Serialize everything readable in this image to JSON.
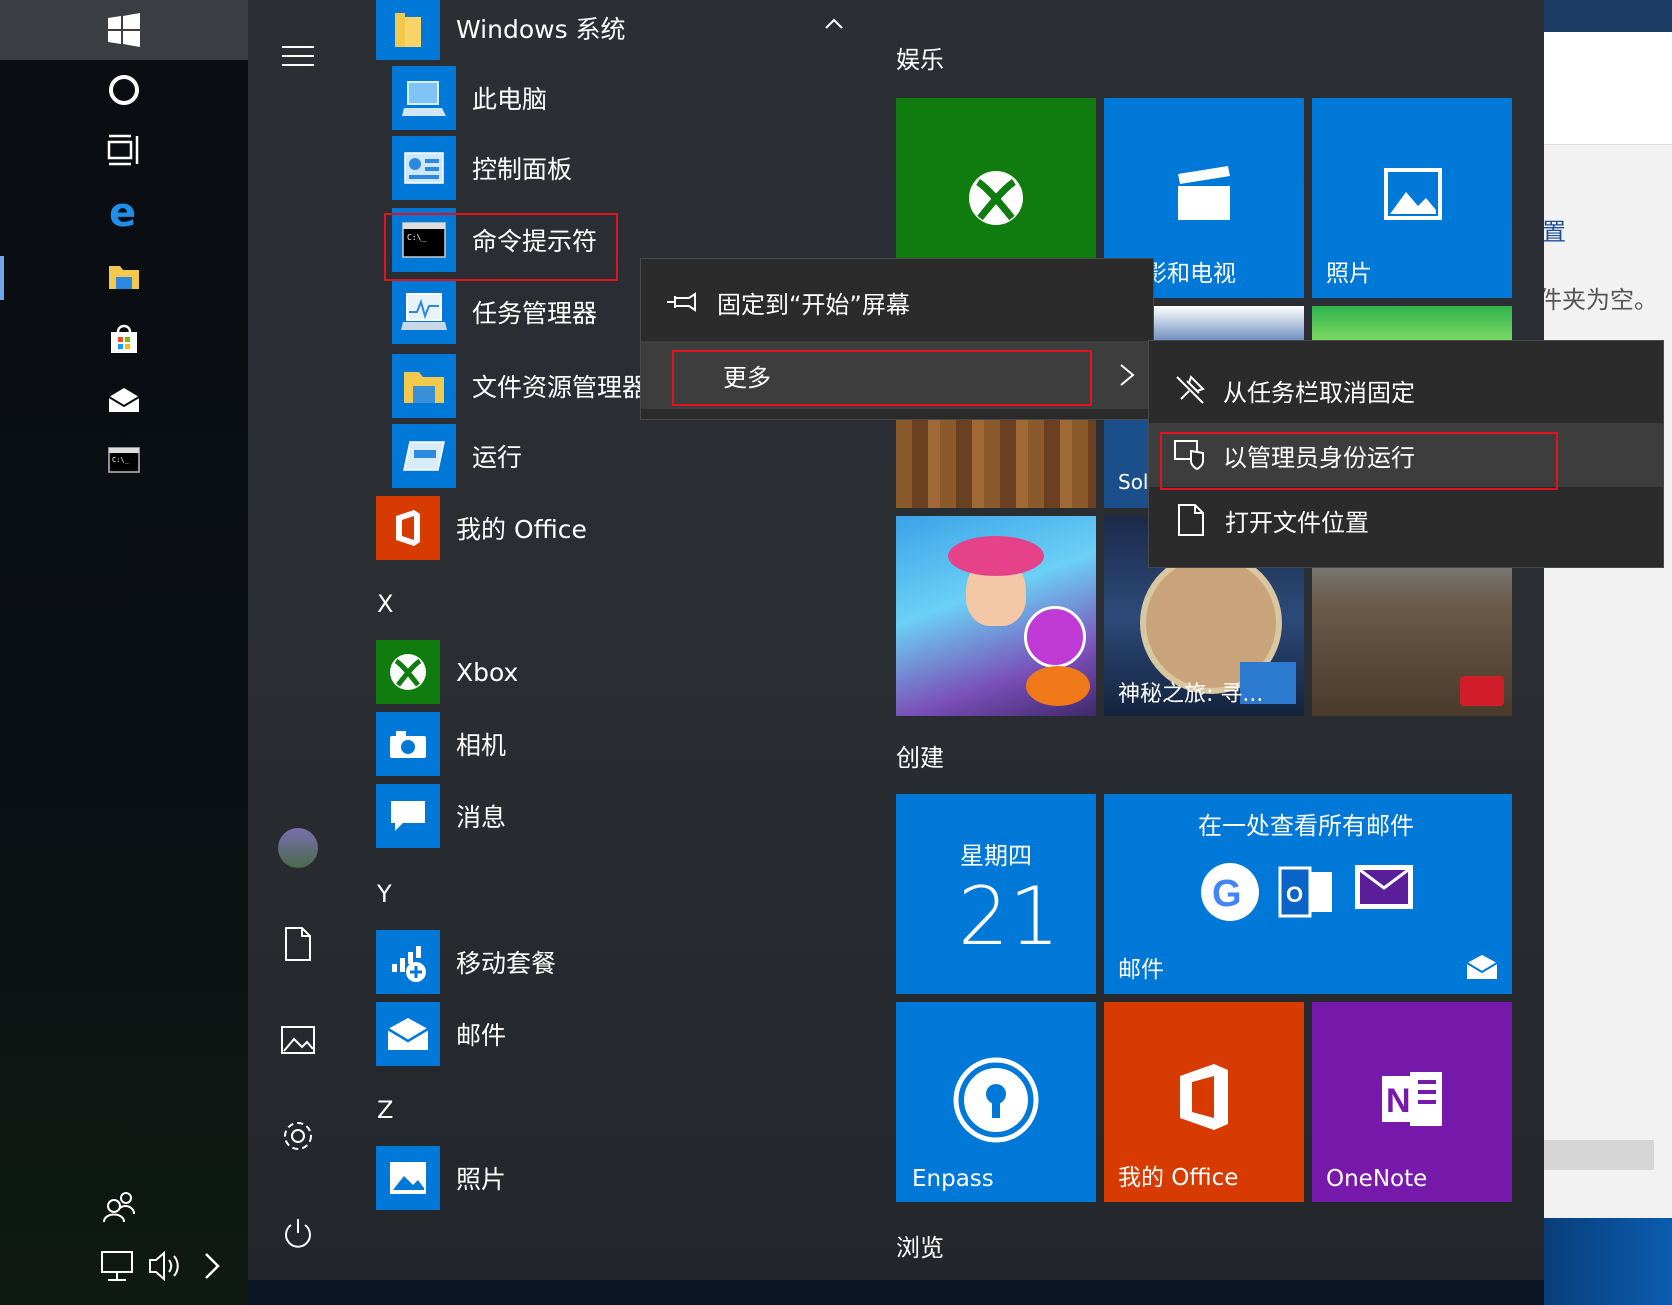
{
  "taskbar": {
    "icons": [
      "windows-logo-icon",
      "cortana-icon",
      "task-view-icon",
      "edge-icon",
      "file-explorer-icon",
      "store-icon",
      "mail-icon",
      "cmd-icon",
      "people-icon",
      "network-icon",
      "volume-icon",
      "chevron-right-icon"
    ]
  },
  "start": {
    "rail_icons": [
      "hamburger-icon",
      "avatar",
      "documents-icon",
      "pictures-icon",
      "settings-icon",
      "power-icon"
    ],
    "folder": {
      "label": "Windows 系统"
    },
    "system_apps": [
      {
        "label": "此电脑",
        "icon": "this-pc-icon"
      },
      {
        "label": "控制面板",
        "icon": "control-panel-icon"
      },
      {
        "label": "命令提示符",
        "icon": "cmd-icon"
      },
      {
        "label": "任务管理器",
        "icon": "task-manager-icon"
      },
      {
        "label": "文件资源管理器",
        "icon": "file-explorer-icon"
      },
      {
        "label": "运行",
        "icon": "run-icon"
      }
    ],
    "office_app": {
      "label": "我的 Office"
    },
    "letters": {
      "x": "X",
      "y": "Y",
      "z": "Z"
    },
    "x_apps": [
      {
        "label": "Xbox"
      },
      {
        "label": "相机"
      },
      {
        "label": "消息"
      }
    ],
    "y_apps": [
      {
        "label": "移动套餐"
      },
      {
        "label": "邮件"
      }
    ],
    "z_apps": [
      {
        "label": "照片"
      }
    ]
  },
  "tiles": {
    "groups": {
      "entertainment": "娱乐",
      "create": "创建",
      "browse": "浏览"
    },
    "movies": {
      "label": "影和电视"
    },
    "photos": {
      "label": "照片"
    },
    "solitaire_partial": "Sol",
    "hidden_object_caption": "神秘之旅: 寻...",
    "calendar": {
      "weekday": "星期四",
      "day": "21"
    },
    "mail": {
      "header": "在一处查看所有邮件",
      "label": "邮件"
    },
    "enpass": {
      "label": "Enpass"
    },
    "office": {
      "label": "我的 Office"
    },
    "onenote": {
      "label": "OneNote"
    }
  },
  "context_menu": {
    "items": [
      {
        "label": "固定到“开始”屏幕",
        "icon": "pin-icon"
      },
      {
        "label": "更多",
        "icon": "chevron-right-icon"
      }
    ]
  },
  "submenu": {
    "items": [
      {
        "label": "从任务栏取消固定",
        "icon": "unpin-icon"
      },
      {
        "label": "以管理员身份运行",
        "icon": "admin-shield-icon"
      },
      {
        "label": "打开文件位置",
        "icon": "file-icon"
      }
    ]
  },
  "background_window": {
    "text1": "置",
    "text2": "件夹为空。"
  },
  "colors": {
    "accent_blue": "#0078d7",
    "xbox_green": "#107c10",
    "office_orange": "#d83b01",
    "onenote_purple": "#7719aa",
    "highlight_red": "#e0141e"
  }
}
